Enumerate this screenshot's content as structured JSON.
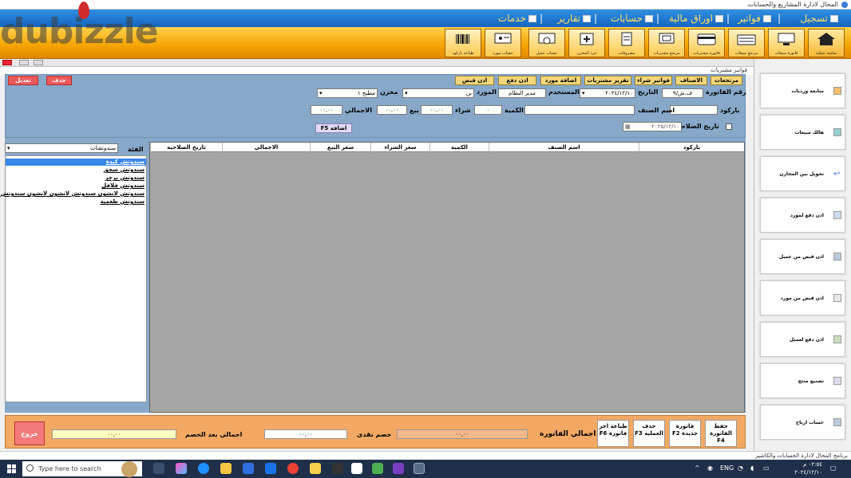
{
  "window": {
    "title": "المحال لادارة المشاريع والحسابات"
  },
  "watermark": "dubizzle",
  "menu": [
    {
      "label": "تسجيل"
    },
    {
      "label": "فواتير"
    },
    {
      "label": "اوراق مالية"
    },
    {
      "label": "حسابات"
    },
    {
      "label": "تقارير"
    },
    {
      "label": "خدمات"
    }
  ],
  "toolbar": [
    {
      "label": "شاشة عملية",
      "icon": "home-icon"
    },
    {
      "label": "فاتورة مبيعات",
      "icon": "computer-icon"
    },
    {
      "label": "مرتجع مبيعات",
      "icon": "register-icon"
    },
    {
      "label": "فاتورة مشتريات",
      "icon": "card-icon"
    },
    {
      "label": "مرتجع مشتريات",
      "icon": "monitor-icon"
    },
    {
      "label": "مصروفات",
      "icon": "document-icon"
    },
    {
      "label": "جرد المخزن",
      "icon": "add-doc-icon"
    },
    {
      "label": "حساب عميل",
      "icon": "certificate-icon"
    },
    {
      "label": "حساب مورد",
      "icon": "screen-icon"
    },
    {
      "label": "طباعة باركود",
      "icon": "barcode-icon"
    }
  ],
  "form": {
    "window_title": "فواتير مشتريات",
    "buttons": {
      "delete": "حذف",
      "edit": "تعديل",
      "returns": "مرتجعات",
      "items": "الاصناف",
      "purchase_invoices": "فواتير شراء",
      "purchase_report": "تقرير مشتريات",
      "add_supplier": "اضافة مورد",
      "payment_voucher": "اذن دفع",
      "receipt_voucher": "اذن قبض",
      "add_f5": "اضافة F5"
    },
    "labels": {
      "invoice_no": "رقم الفاتورة",
      "date": "التاريخ",
      "user": "المستخدم",
      "supplier": "المورد",
      "store": "مخزن",
      "barcode": "باركود",
      "item_name": "اسم الصنف",
      "quantity": "الكمية",
      "purchase": "شراء",
      "sale": "بيع",
      "total": "الاجمالي",
      "expiry_date": "تاريخ الصلاحية",
      "category": "الفئة"
    },
    "values": {
      "invoice_no": "ف.ش/٩",
      "date": "٢٠٢٤/١٢/١٠",
      "user": "مدير النظام",
      "supplier": "بن",
      "store": "مطبخ ١",
      "barcode": "",
      "item_name": "",
      "quantity": "٠",
      "purchase": "٠٠,٠٠",
      "sale": "٠٠,٠٠",
      "total": "٠٠,٠٠",
      "expiry_date": "٢٠٢٥/١٢/١٠",
      "category": "سندوتشات"
    }
  },
  "categories": [
    "سندوتش كبدة",
    "سندوتش سجق",
    "سندوتش برجر",
    "سندوتش فلافل",
    "سندوتش لانشون سندوتش لانشون لانشون سندوتش لانشون",
    "سندوتش طعمية"
  ],
  "grid": {
    "columns": [
      "باركود",
      "اسم الصنف",
      "الكمية",
      "سعر الشراء",
      "سعر البيع",
      "الاجمالي",
      "تاريخ الصلاحية"
    ]
  },
  "bottom": {
    "buttons": {
      "save": "حفظ الفاتورة F4",
      "new": "فاتورة جديدة F2",
      "delete_op": "حذف العملية F3",
      "print_last": "طباعة اخر فاتورة F6",
      "exit": "خروج"
    },
    "labels": {
      "invoice_total": "اجمالي الفاتورة",
      "cash_discount": "خصم نقدى",
      "total_after_discount": "اجمالي بعد الخصم"
    },
    "values": {
      "invoice_total": "٠٠,٠٠",
      "cash_discount": "٠٠,٠٠",
      "total_after_discount": "٠٠,٠٠"
    }
  },
  "side_nav": [
    "متابعة ورديات",
    "هالك مبيعات",
    "تحويل بين المخازن",
    "اذن دفع لمورد",
    "اذن قبض من عميل",
    "اذن قبض من مورد",
    "اذن دفع لعميل",
    "تصنيع منتج",
    "حساب ارباح"
  ],
  "status": {
    "text": "برنامج المحال لادارة الحسابات والكاشير"
  },
  "taskbar": {
    "search_placeholder": "Type here to search",
    "lang": "ENG",
    "time": "٠٢:٥٤ م",
    "date": "٢٠٢٤/١٢/١٠"
  }
}
